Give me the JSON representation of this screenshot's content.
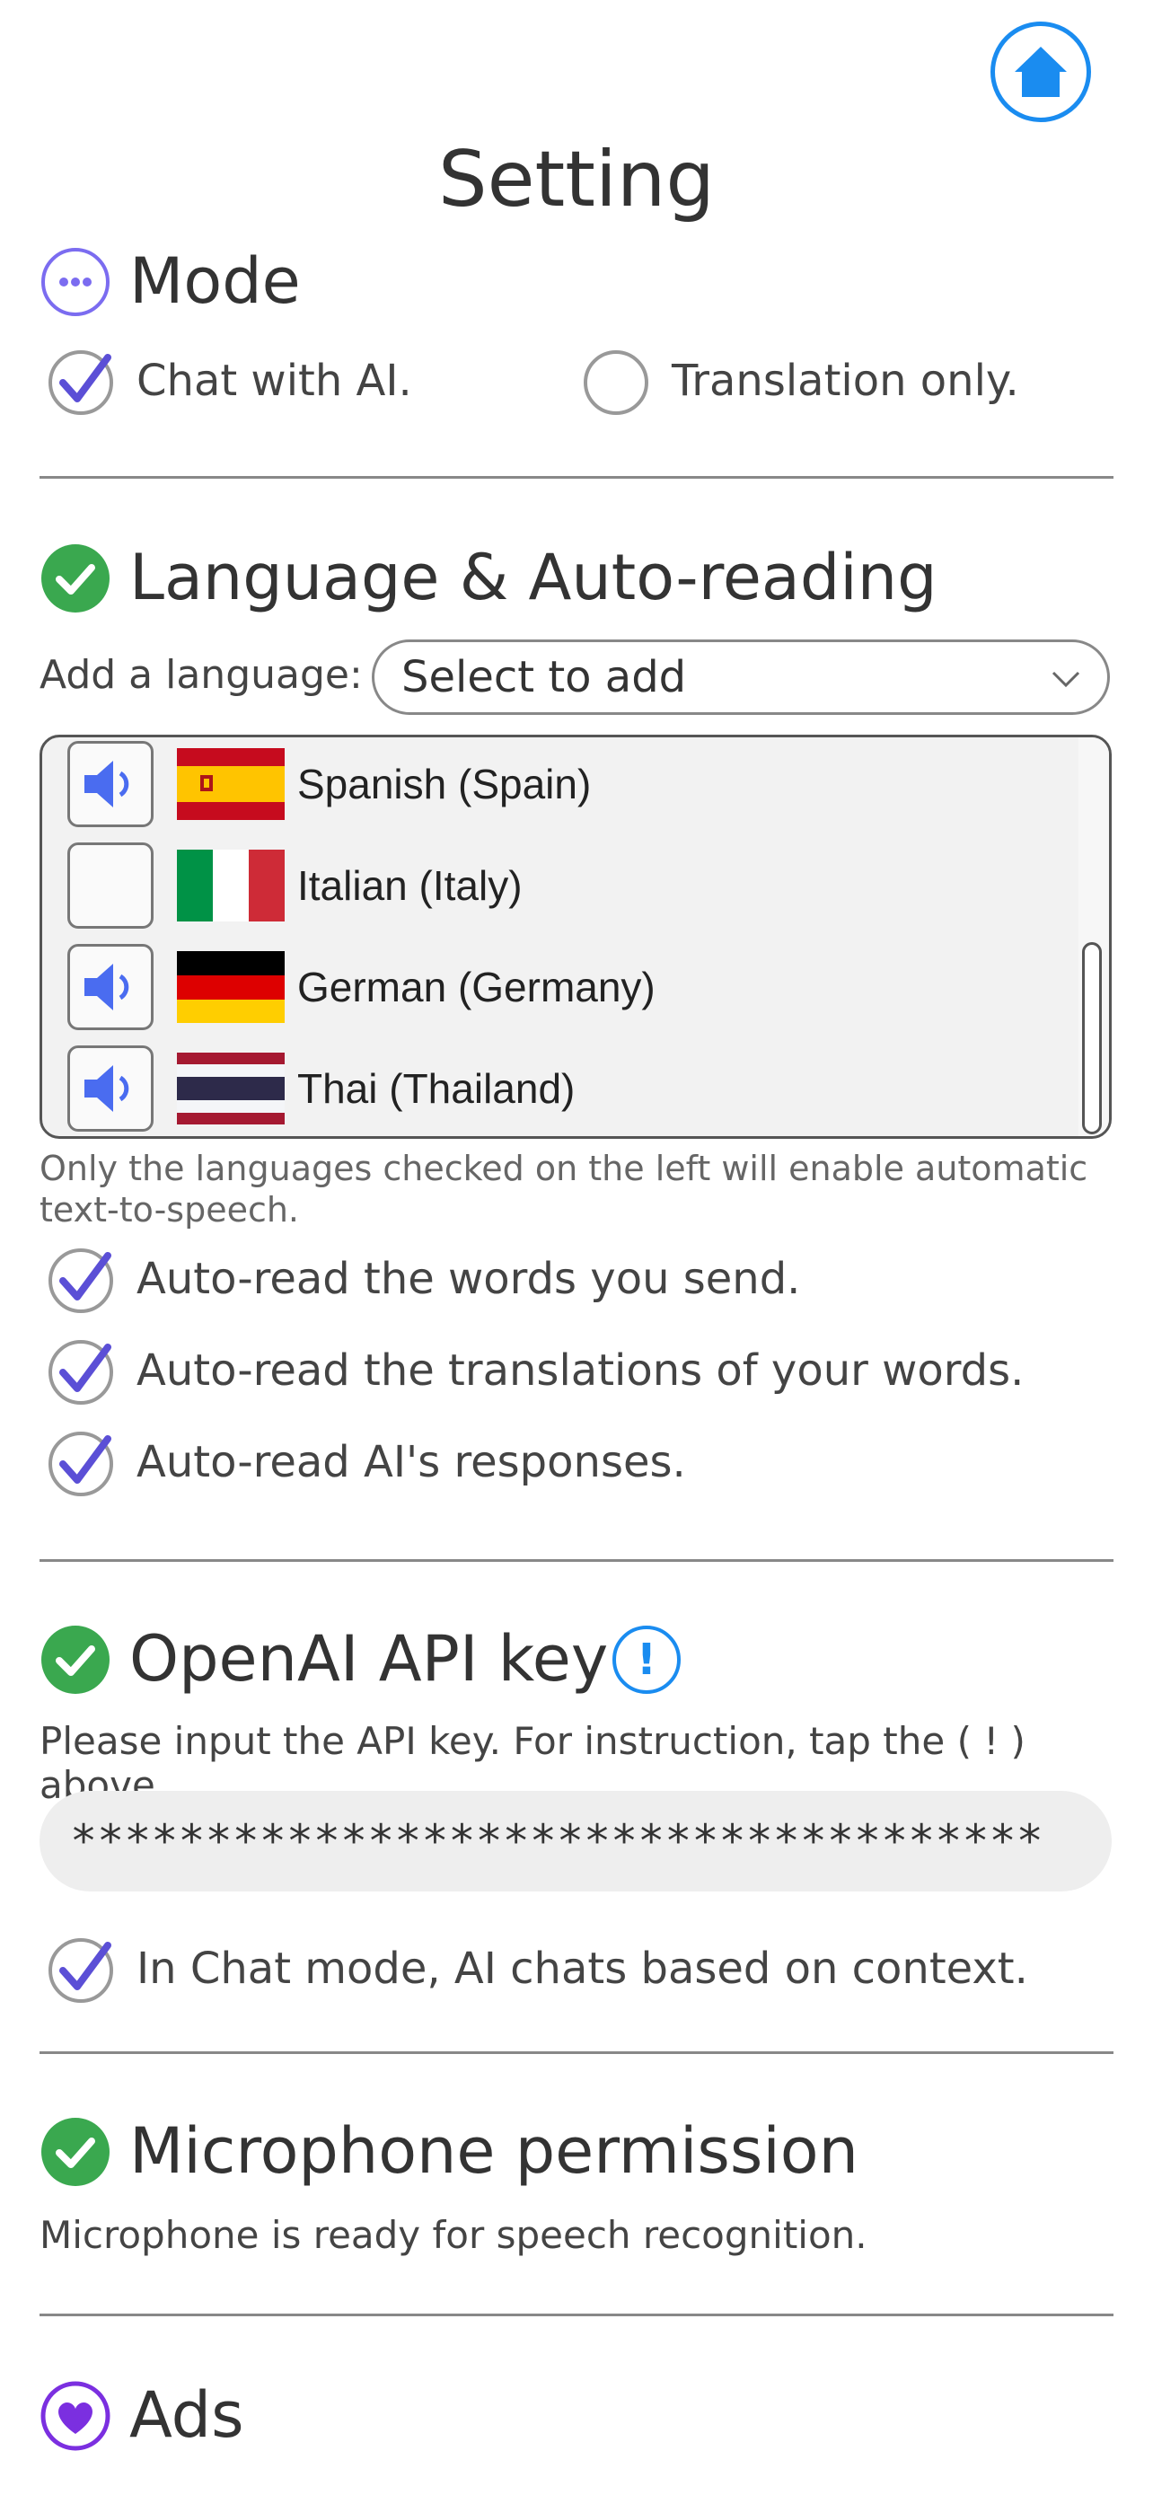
{
  "page_title": "Setting",
  "mode": {
    "title": "Mode",
    "options": [
      {
        "label": "Chat with AI.",
        "checked": true
      },
      {
        "label": "Translation only.",
        "checked": false
      }
    ]
  },
  "language": {
    "title": "Language & Auto-reading",
    "add_label": "Add a language:",
    "select_value": "Select to add",
    "items": [
      {
        "name": "Spanish (Spain)",
        "auto_read": true,
        "flag": "spain-flag"
      },
      {
        "name": "Italian (Italy)",
        "auto_read": false,
        "flag": "italy-flag"
      },
      {
        "name": "German (Germany)",
        "auto_read": true,
        "flag": "germany-flag"
      },
      {
        "name": "Thai (Thailand)",
        "auto_read": true,
        "flag": "thailand-flag"
      }
    ],
    "note": "Only the languages checked on the left will enable automatic text-to-speech.",
    "auto_options": [
      {
        "label": "Auto-read the words you send.",
        "checked": true
      },
      {
        "label": "Auto-read the translations of your words.",
        "checked": true
      },
      {
        "label": "Auto-read AI's responses.",
        "checked": true
      }
    ]
  },
  "openai": {
    "title": "OpenAI API key",
    "info_symbol": "!",
    "instruction": "Please input the API key. For instruction, tap the ( ! ) above.",
    "key_value": "************************************",
    "context_option": {
      "label": "In Chat mode, AI chats based on context.",
      "checked": true
    }
  },
  "microphone": {
    "title": "Microphone permission",
    "status": "Microphone is ready for speech recognition."
  },
  "ads": {
    "title": "Ads"
  },
  "colors": {
    "accent": "#5b4fd6",
    "success": "#3aa84f",
    "home_blue": "#1a8cf0",
    "speaker_blue": "#4a6cf0",
    "heart_purple": "#7b2fe0"
  }
}
